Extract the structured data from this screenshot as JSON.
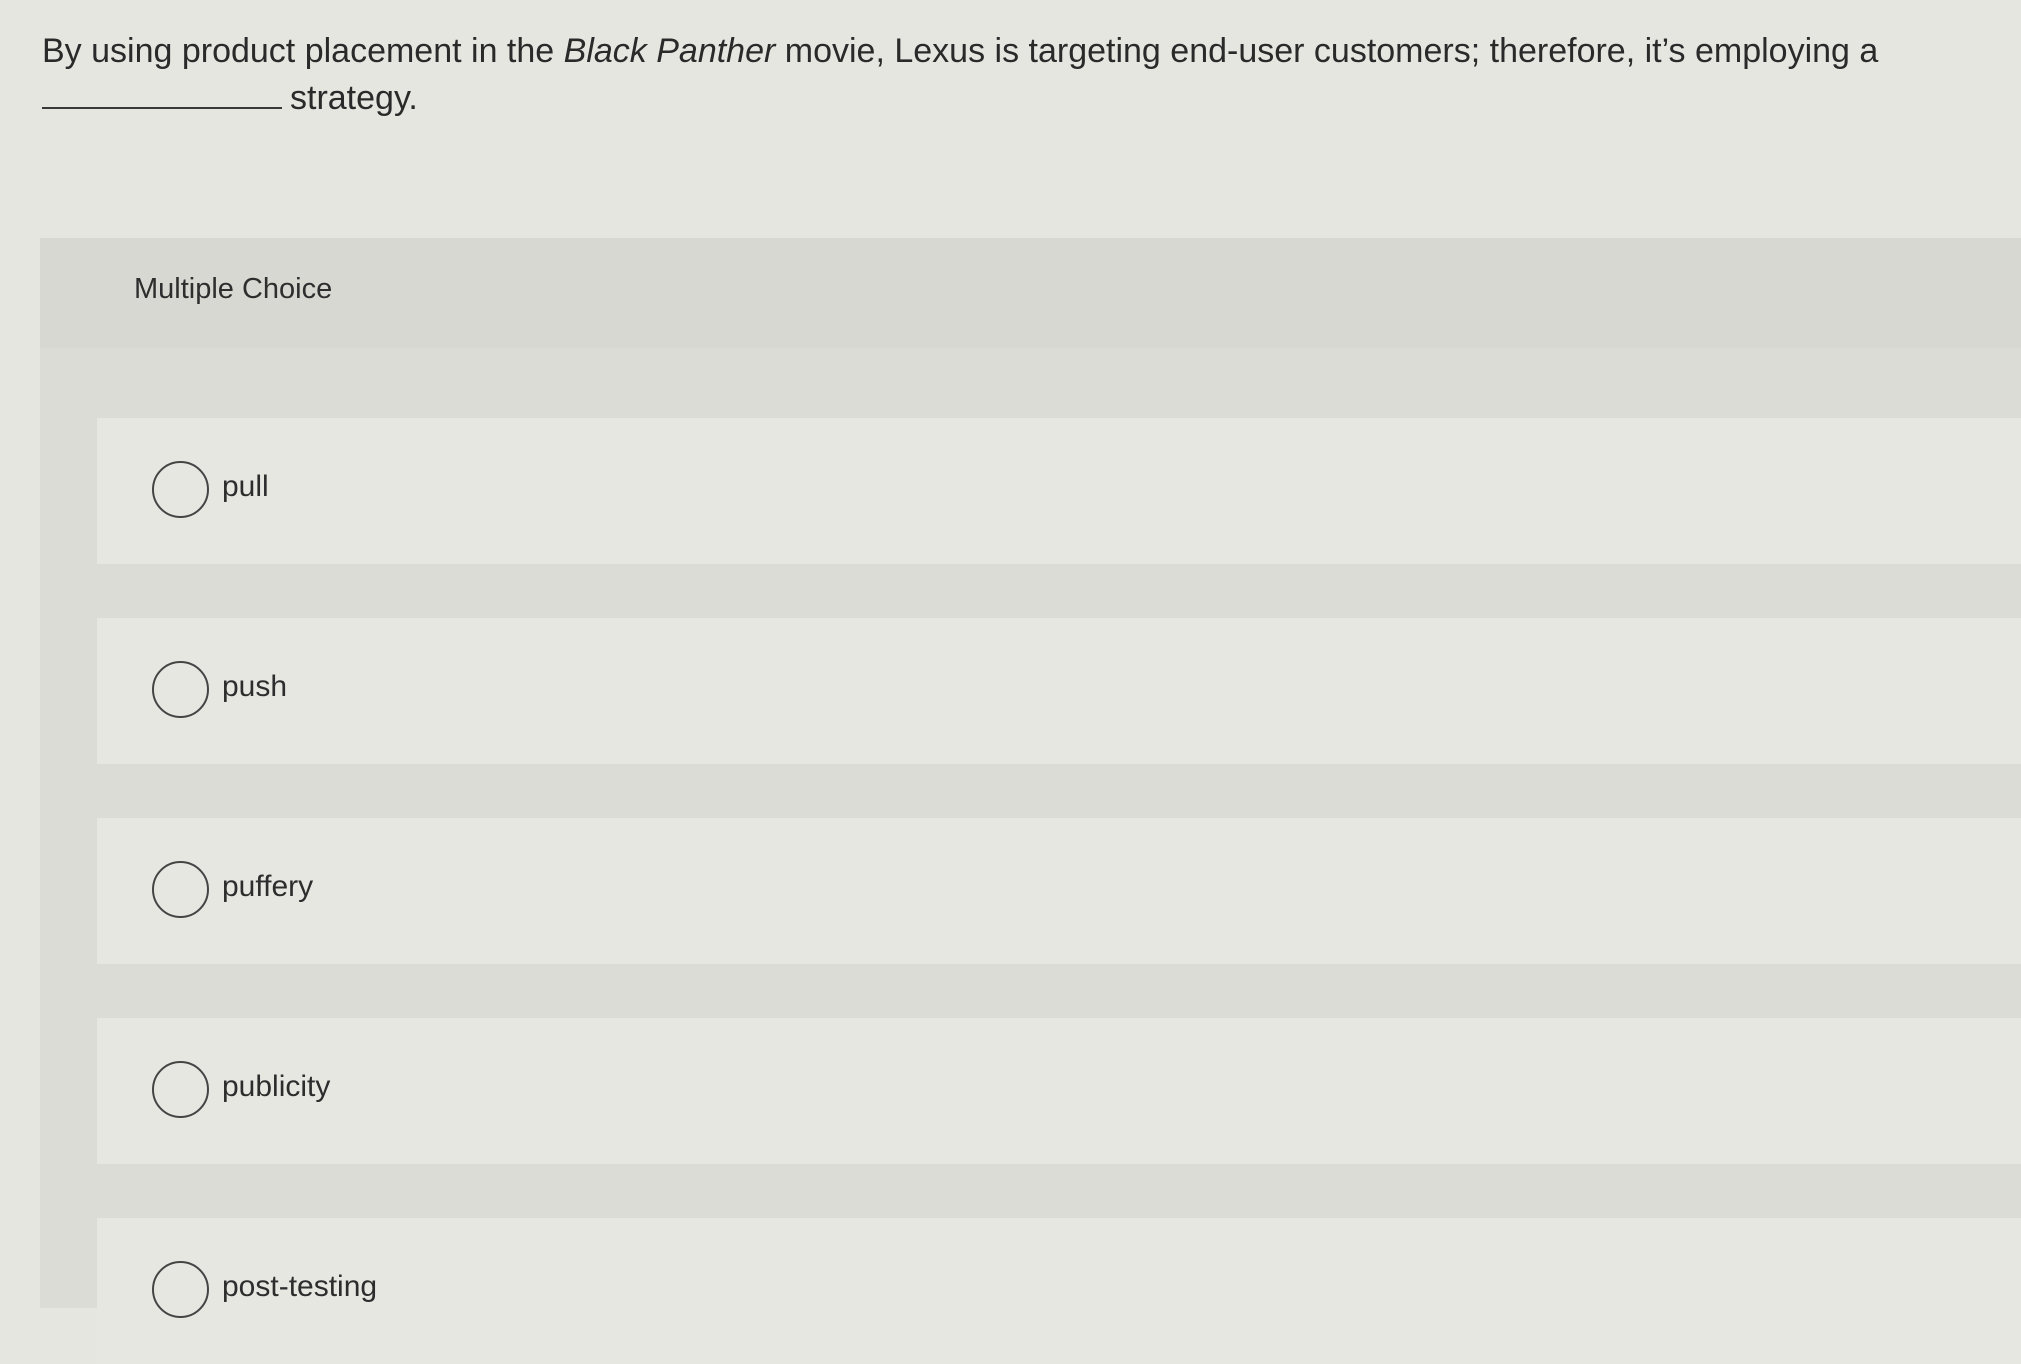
{
  "question": {
    "text_before": "By using product placement in the ",
    "emphasis": "Black Panther",
    "text_after": " movie, Lexus is targeting end-user customers; therefore, it’s employing a",
    "text_end": "strategy."
  },
  "panel": {
    "title": "Multiple Choice"
  },
  "options": [
    {
      "label": "pull"
    },
    {
      "label": "push"
    },
    {
      "label": "puffery"
    },
    {
      "label": "publicity"
    },
    {
      "label": "post-testing"
    }
  ],
  "colors": {
    "background": "#e6e6e1",
    "panel": "#dcdcd7",
    "option": "#e7e7e2",
    "text": "#2b2b2b"
  }
}
